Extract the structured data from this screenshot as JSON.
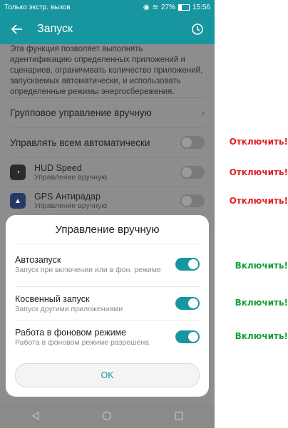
{
  "status_bar": {
    "left_text": "Только экстр. вызов",
    "battery": "27%",
    "time": "15:56"
  },
  "app_bar": {
    "title": "Запуск"
  },
  "description": "Эта функция позволяет выполнять идентификацию определенных приложений и сценариев, ограничивать количество приложений, запускаемых автоматически, и использовать определенные режимы энергосбережения.",
  "group_manual": {
    "label": "Групповое управление вручную"
  },
  "manage_all": {
    "label": "Управлять всем автоматически"
  },
  "apps": [
    {
      "name": "HUD Speed",
      "subtitle": "Управление вручную"
    },
    {
      "name": "GPS Антирадар",
      "subtitle": "Управление вручную"
    }
  ],
  "dialog": {
    "title": "Управление вручную",
    "items": [
      {
        "title": "Автозапуск",
        "subtitle": "Запуск при включении или в фон. режиме"
      },
      {
        "title": "Косвенный запуск",
        "subtitle": "Запуск другими приложениями"
      },
      {
        "title": "Работа в фоновом режиме",
        "subtitle": "Работа в фоновом режиме разрешена"
      }
    ],
    "ok_label": "OK"
  },
  "annotations": {
    "disable": "Отключить!",
    "enable": "Включить!"
  },
  "colors": {
    "accent": "#17969f",
    "disable_red": "#e02222",
    "enable_green": "#15a03a"
  }
}
